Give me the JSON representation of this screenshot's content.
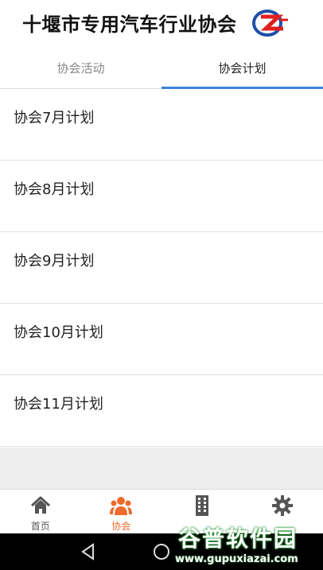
{
  "header": {
    "title": "十堰市专用汽车行业协会"
  },
  "tabs": [
    {
      "label": "协会活动",
      "active": false
    },
    {
      "label": "协会计划",
      "active": true
    }
  ],
  "plans": [
    {
      "label": "协会7月计划"
    },
    {
      "label": "协会8月计划"
    },
    {
      "label": "协会9月计划"
    },
    {
      "label": "协会10月计划"
    },
    {
      "label": "协会11月计划"
    }
  ],
  "bottom_nav": [
    {
      "label": "首页",
      "icon": "home-icon",
      "active": false
    },
    {
      "label": "协会",
      "icon": "group-icon",
      "active": true
    },
    {
      "label": "",
      "icon": "building-icon",
      "active": false
    },
    {
      "label": "",
      "icon": "gear-icon",
      "active": false
    }
  ],
  "watermark": {
    "title": "谷普软件园",
    "url": "www.gupuxiazai.com"
  },
  "colors": {
    "accent_tab": "#3b82d8",
    "nav_active": "#f06a2a",
    "logo_blue": "#1e4fa8",
    "logo_red": "#e02020"
  }
}
